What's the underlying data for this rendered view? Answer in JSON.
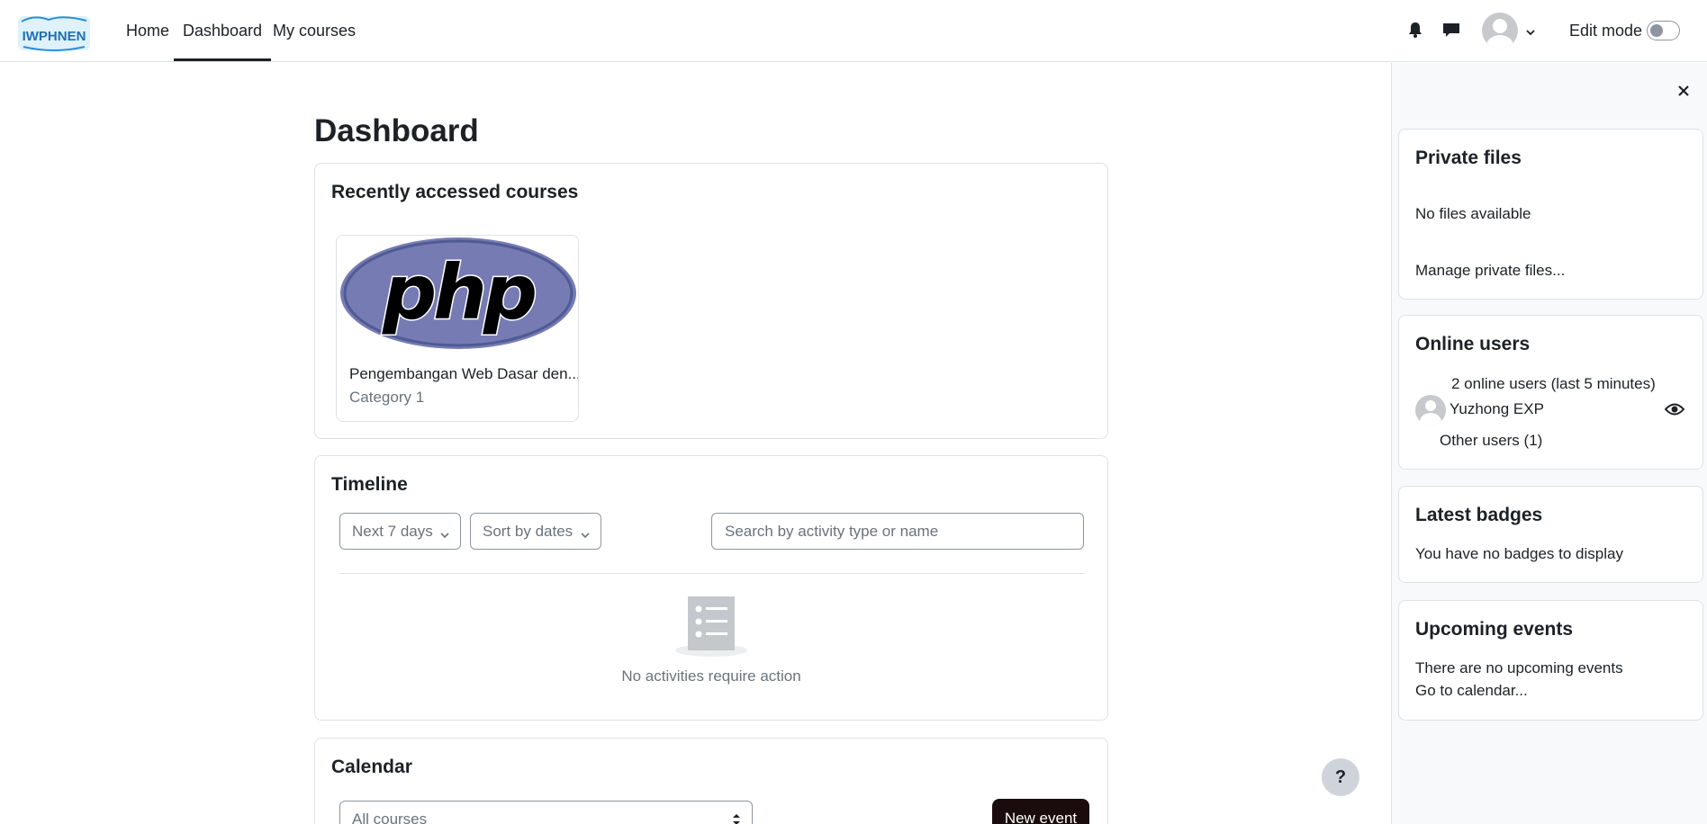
{
  "nav": {
    "links": [
      "Home",
      "Dashboard",
      "My courses"
    ],
    "edit_mode_label": "Edit mode",
    "logo_text": "IWPHNEN"
  },
  "page": {
    "title": "Dashboard"
  },
  "recent_courses": {
    "title": "Recently accessed courses",
    "courses": [
      {
        "name": "Pengembangan Web Dasar den...",
        "category": "Category 1",
        "image_text": "php"
      }
    ]
  },
  "timeline": {
    "title": "Timeline",
    "filter_label": "Next 7 days",
    "sort_label": "Sort by dates",
    "search_placeholder": "Search by activity type or name",
    "empty_text": "No activities require action"
  },
  "calendar": {
    "title": "Calendar",
    "course_select": "All courses",
    "new_event_label": "New event"
  },
  "help": {
    "label": "?"
  },
  "drawer": {
    "private_files": {
      "title": "Private files",
      "empty": "No files available",
      "manage_link": "Manage private files..."
    },
    "online_users": {
      "title": "Online users",
      "summary": "2 online users (last 5 minutes)",
      "user_name": "Yuzhong EXP",
      "other_users": "Other users (1)"
    },
    "badges": {
      "title": "Latest badges",
      "empty": "You have no badges to display"
    },
    "events": {
      "title": "Upcoming events",
      "empty": "There are no upcoming events",
      "calendar_link": "Go to calendar..."
    }
  },
  "colors": {
    "text": "#1d2125",
    "muted": "#6a737b",
    "border": "#dee2e6",
    "primary_button": "#1a0b0c",
    "php_logo": "#777bb3"
  }
}
